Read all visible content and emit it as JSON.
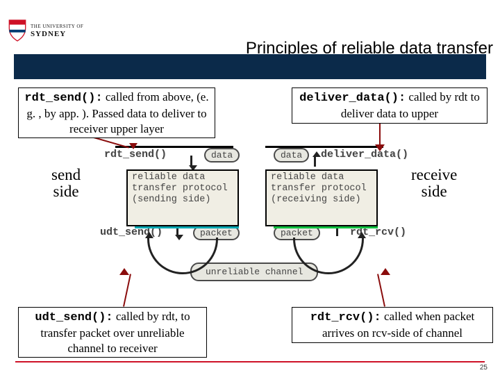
{
  "header": {
    "uni_line1": "THE UNIVERSITY OF",
    "uni_line2": "SYDNEY",
    "title": "Principles of reliable data transfer"
  },
  "boxes": {
    "rdt_send": {
      "fn": "rdt_send():",
      "desc": " called from above, (e. g. , by app. ). Passed data to deliver to receiver upper layer"
    },
    "deliver_data": {
      "fn": "deliver_data():",
      "desc": " called by rdt to deliver data to upper"
    },
    "udt_send": {
      "fn": "udt_send():",
      "desc": " called by rdt, to transfer packet over unreliable channel to receiver"
    },
    "rdt_rcv": {
      "fn": "rdt_rcv():",
      "desc": " called when packet arrives on rcv-side of channel"
    }
  },
  "side": {
    "send": "send\nside",
    "recv": "receive\nside"
  },
  "diag": {
    "rdt_send": "rdt_send()",
    "deliver": "deliver_data()",
    "udt_send": "udt_send()",
    "rdt_rcv": "rdt_rcv()",
    "data": "data",
    "packet": "packet",
    "channel": "unreliable channel",
    "proto_send": "reliable data\ntransfer protocol\n(sending side)",
    "proto_recv": "reliable data\ntransfer protocol\n(receiving side)"
  },
  "page": "25"
}
